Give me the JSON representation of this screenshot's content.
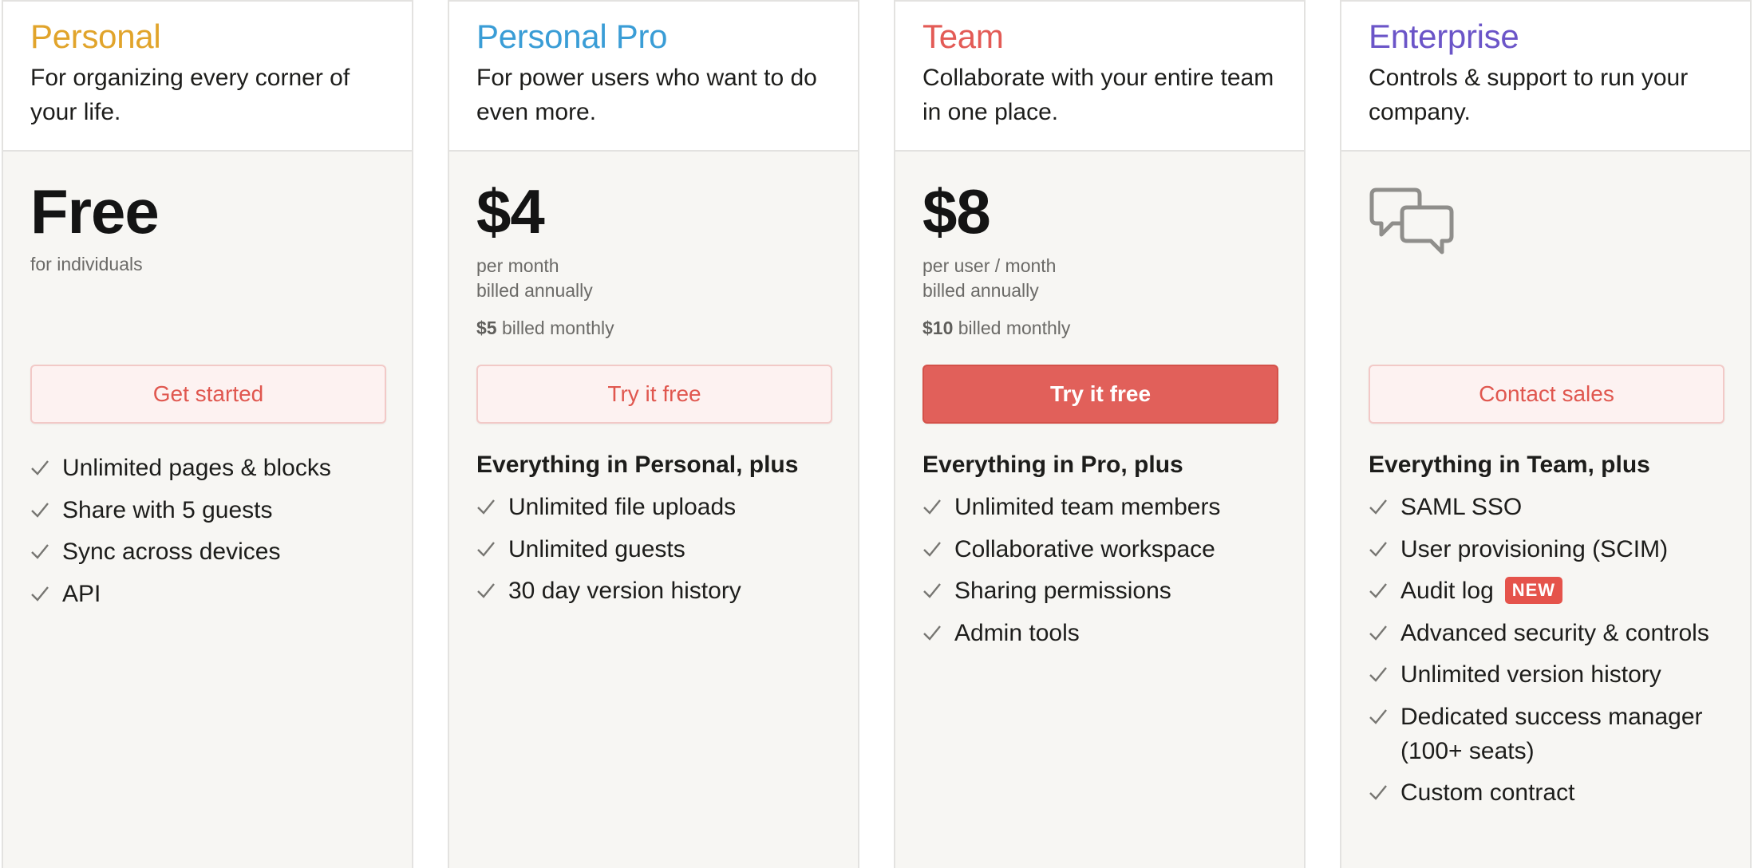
{
  "plans": [
    {
      "name": "Personal",
      "color": "#e1a42b",
      "tagline": "For organizing every corner of your life.",
      "price": "Free",
      "price_note": "for individuals",
      "cta": "Get started",
      "features_heading": "",
      "features": [
        "Unlimited pages & blocks",
        "Share with 5 guests",
        "Sync across devices",
        "API"
      ]
    },
    {
      "name": "Personal Pro",
      "color": "#3a9dd6",
      "tagline": "For power users who want to do even more.",
      "price": "$4",
      "price_note": "per month",
      "price_note2": "billed annually",
      "monthly_amount": "$5",
      "monthly_label": "billed monthly",
      "cta": "Try it free",
      "features_heading": "Everything in Personal, plus",
      "features": [
        "Unlimited file uploads",
        "Unlimited guests",
        "30 day version history"
      ]
    },
    {
      "name": "Team",
      "color": "#e35b56",
      "tagline": "Collaborate with your entire team in one place.",
      "price": "$8",
      "price_note": "per user / month",
      "price_note2": "billed annually",
      "monthly_amount": "$10",
      "monthly_label": "billed monthly",
      "cta": "Try it free",
      "features_heading": "Everything in Pro, plus",
      "features": [
        "Unlimited team members",
        "Collaborative workspace",
        "Sharing permissions",
        "Admin tools"
      ]
    },
    {
      "name": "Enterprise",
      "color": "#6b55c8",
      "tagline": "Controls & support to run your company.",
      "price_icon": "chat-bubbles-icon",
      "cta": "Contact sales",
      "features_heading": "Everything in Team, plus",
      "features": [
        "SAML SSO",
        "User provisioning (SCIM)",
        "Audit log",
        "Advanced security & controls",
        "Unlimited version history",
        "Dedicated success manager (100+ seats)",
        "Custom contract"
      ],
      "badge": "NEW"
    }
  ],
  "icons": {
    "check": "check-icon",
    "chat": "chat-bubbles-icon"
  }
}
